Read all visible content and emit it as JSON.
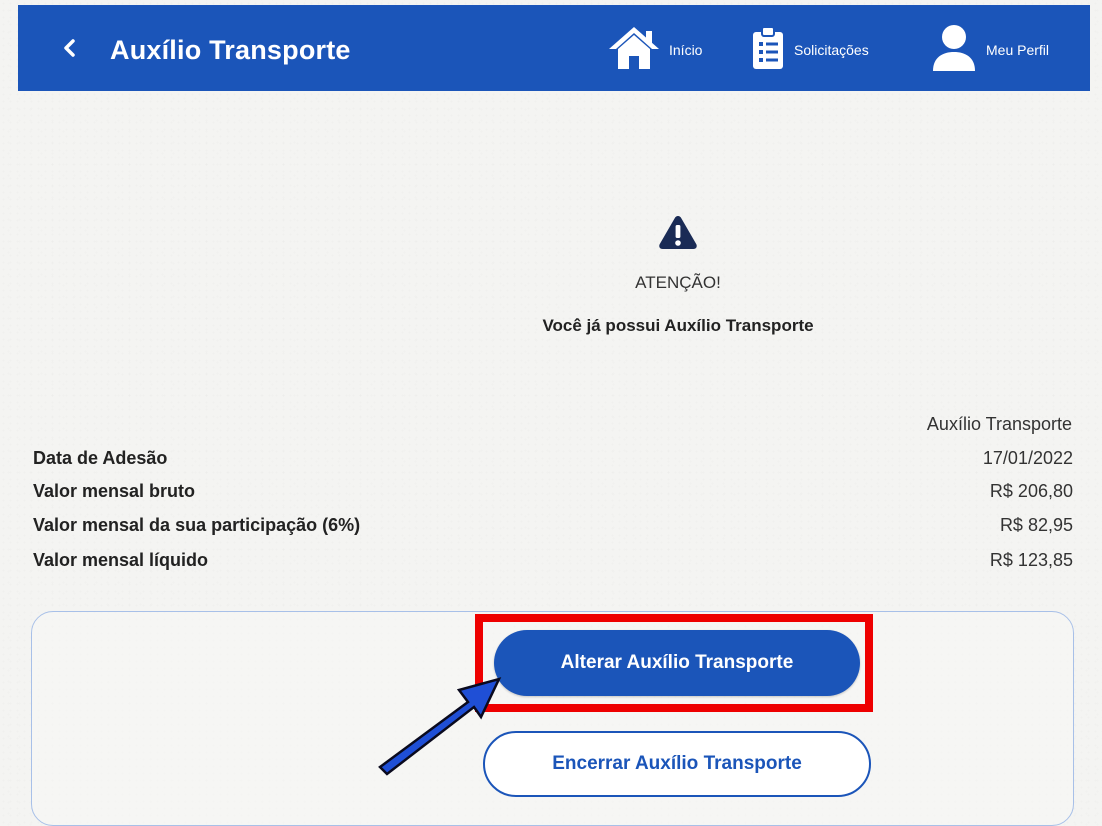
{
  "header": {
    "title": "Auxílio Transporte",
    "back_icon": "chevron-left-icon",
    "nav": [
      {
        "label": "Início",
        "icon": "home-icon"
      },
      {
        "label": "Solicitações",
        "icon": "clipboard-list-icon"
      },
      {
        "label": "Meu Perfil",
        "icon": "user-icon"
      }
    ]
  },
  "alert": {
    "icon": "warning-triangle-icon",
    "title": "ATENÇÃO!",
    "message": "Você já possui Auxílio Transporte"
  },
  "details": {
    "column_header": "Auxílio Transporte",
    "rows": [
      {
        "label": "Data de Adesão",
        "value": "17/01/2022"
      },
      {
        "label": "Valor mensal bruto",
        "value": "R$ 206,80"
      },
      {
        "label": "Valor mensal da sua participação (6%)",
        "value": "R$ 82,95"
      },
      {
        "label": "Valor mensal líquido",
        "value": "R$ 123,85"
      }
    ]
  },
  "actions": {
    "alter_label": "Alterar Auxílio Transporte",
    "end_label": "Encerrar Auxílio Transporte"
  },
  "annotations": {
    "highlight_color": "#ee0000",
    "arrow_color": "#1f4fd6",
    "arrow_icon": "arrow-up-right-icon"
  },
  "colors": {
    "primary": "#1b55b9",
    "header_text": "#ffffff"
  }
}
